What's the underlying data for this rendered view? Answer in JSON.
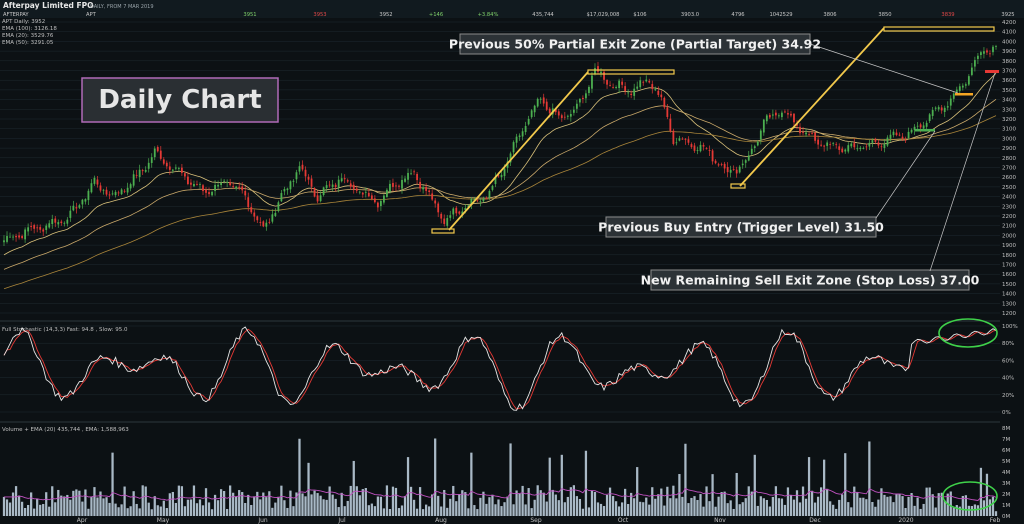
{
  "header": {
    "title": "Afterpay Limited FPO",
    "subtitle": "DAILY, FROM 7 MAR 2019",
    "quote_cells": [
      "AFTERPAY",
      "APT",
      "3951",
      "3953",
      "3952",
      "+146",
      "+3.84%",
      "435,744",
      "$17,029,008",
      "$106",
      "3903.0",
      "4796",
      "1042529",
      "3806",
      "3850",
      "3839",
      "3925"
    ],
    "quote_colors": [
      "#c8c8c8",
      "#c8c8c8",
      "#7fd06a",
      "#e04848",
      "#c8c8c8",
      "#7fd06a",
      "#7fd06a",
      "#c8c8c8",
      "#c8c8c8",
      "#c8c8c8",
      "#c8c8c8",
      "#c8c8c8",
      "#c8c8c8",
      "#c8c8c8",
      "#c8c8c8",
      "#e04848",
      "#c8c8c8"
    ]
  },
  "legend": {
    "lines": [
      "APT Daily: 3952",
      "EMA (100): 3126.18",
      "EMA (20): 3529.76",
      "EMA (50): 3291.05"
    ]
  },
  "stoch_legend": "Full Stochastic (14,3,3) Fast: 94.8 , Slow: 95.0",
  "volume_legend": "Volume + EMA (20) 435,744 , EMA: 1,588,963",
  "daily_label": "Daily Chart",
  "annotations": {
    "target": "Previous 50% Partial Exit Zone (Partial Target) 34.92",
    "entry": "Previous Buy Entry (Trigger Level) 31.50",
    "stop": "New Remaining Sell Exit Zone (Stop Loss) 37.00"
  },
  "colors": {
    "background": "#0c1114",
    "grid": "#1f2a30",
    "up": "#4caf50",
    "down": "#e53935",
    "trend": "#f2c94c",
    "stoch_fast": "#e6e6e6",
    "stoch_slow": "#e53935",
    "volume": "#a9b9c6",
    "volume_ema": "#c050c0",
    "circle": "#3fd14a",
    "label_border": "#b06ab8"
  },
  "chart_data": [
    {
      "type": "candlestick",
      "ylim": [
        1200,
        4200
      ],
      "yticks": [
        4200,
        4100,
        4000,
        3900,
        3800,
        3700,
        3600,
        3500,
        3400,
        3300,
        3200,
        3100,
        3000,
        2900,
        2800,
        2700,
        2600,
        2500,
        2400,
        2300,
        2200,
        2100,
        2000,
        1900,
        1800,
        1700,
        1600,
        1500,
        1400,
        1300,
        1200
      ],
      "x_months": [
        "Apr",
        "May",
        "Jun",
        "Jul",
        "Aug",
        "Sep",
        "Oct",
        "Nov",
        "Dec",
        "2020",
        "Feb"
      ],
      "key_points": [
        {
          "x": 0,
          "close": 1950
        },
        {
          "x": 8,
          "close": 2050
        },
        {
          "x": 14,
          "close": 2100
        },
        {
          "x": 22,
          "close": 2200
        },
        {
          "x": 30,
          "close": 2550
        },
        {
          "x": 36,
          "close": 2400
        },
        {
          "x": 44,
          "close": 2600
        },
        {
          "x": 50,
          "close": 2850
        },
        {
          "x": 56,
          "close": 2700
        },
        {
          "x": 66,
          "close": 2450
        },
        {
          "x": 74,
          "close": 2550
        },
        {
          "x": 80,
          "close": 2400
        },
        {
          "x": 86,
          "close": 2050
        },
        {
          "x": 92,
          "close": 2400
        },
        {
          "x": 98,
          "close": 2700
        },
        {
          "x": 104,
          "close": 2400
        },
        {
          "x": 112,
          "close": 2600
        },
        {
          "x": 118,
          "close": 2450
        },
        {
          "x": 124,
          "close": 2350
        },
        {
          "x": 130,
          "close": 2550
        },
        {
          "x": 136,
          "close": 2650
        },
        {
          "x": 142,
          "close": 2350
        },
        {
          "x": 146,
          "close": 2150
        },
        {
          "x": 152,
          "close": 2300
        },
        {
          "x": 160,
          "close": 2400
        },
        {
          "x": 166,
          "close": 2700
        },
        {
          "x": 172,
          "close": 3100
        },
        {
          "x": 178,
          "close": 3400
        },
        {
          "x": 184,
          "close": 3200
        },
        {
          "x": 190,
          "close": 3300
        },
        {
          "x": 196,
          "close": 3700
        },
        {
          "x": 202,
          "close": 3550
        },
        {
          "x": 208,
          "close": 3500
        },
        {
          "x": 214,
          "close": 3600
        },
        {
          "x": 218,
          "close": 3400
        },
        {
          "x": 222,
          "close": 3000
        },
        {
          "x": 228,
          "close": 2950
        },
        {
          "x": 234,
          "close": 2850
        },
        {
          "x": 240,
          "close": 2650
        },
        {
          "x": 246,
          "close": 2750
        },
        {
          "x": 252,
          "close": 3150
        },
        {
          "x": 258,
          "close": 3300
        },
        {
          "x": 264,
          "close": 3100
        },
        {
          "x": 270,
          "close": 2950
        },
        {
          "x": 278,
          "close": 2900
        },
        {
          "x": 286,
          "close": 2920
        },
        {
          "x": 294,
          "close": 3000
        },
        {
          "x": 300,
          "close": 3050
        },
        {
          "x": 306,
          "close": 3200
        },
        {
          "x": 312,
          "close": 3350
        },
        {
          "x": 318,
          "close": 3550
        },
        {
          "x": 324,
          "close": 3900
        },
        {
          "x": 329,
          "close": 3952
        }
      ],
      "levels": {
        "partial_target": 3492,
        "buy_entry": 3150,
        "stop_loss": 3700
      },
      "ema_periods": [
        20,
        50,
        100
      ]
    },
    {
      "type": "line",
      "ylim": [
        0,
        100
      ],
      "yticks": [
        100,
        80,
        60,
        40,
        20,
        0
      ],
      "series": [
        {
          "name": "Fast",
          "last": 94.8
        },
        {
          "name": "Slow",
          "last": 95.0
        }
      ]
    },
    {
      "type": "bar",
      "ylim": [
        0,
        8000000
      ],
      "yticks": [
        "8M",
        "7M",
        "6M",
        "5M",
        "4M",
        "3M",
        "2M",
        "1M",
        "0M"
      ],
      "last_volume": 435744,
      "last_ema": 1588963
    }
  ]
}
